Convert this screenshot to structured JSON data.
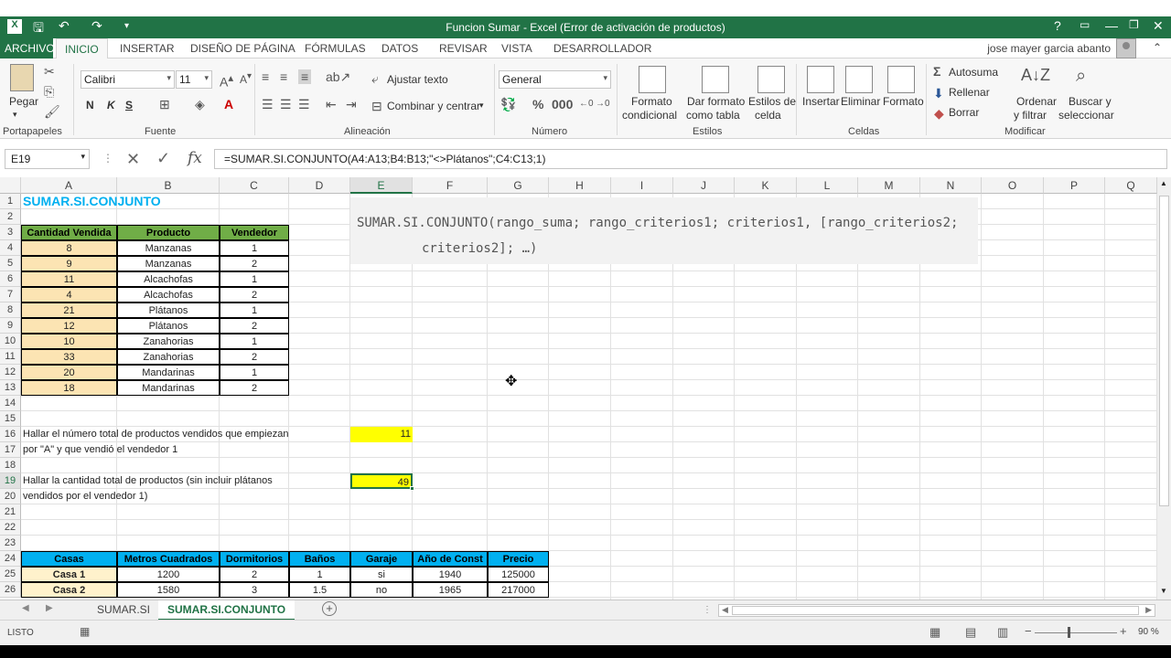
{
  "titlebar": {
    "title": "Funcion Sumar -  Excel (Error de activación de productos)",
    "help": "?",
    "minimize": "—",
    "restore": "❐",
    "close": "✕"
  },
  "tabs": {
    "file": "ARCHIVO",
    "items": [
      "INICIO",
      "INSERTAR",
      "DISEÑO DE PÁGINA",
      "FÓRMULAS",
      "DATOS",
      "REVISAR",
      "VISTA",
      "DESARROLLADOR"
    ],
    "user": "jose mayer garcia abanto"
  },
  "ribbon": {
    "paste": "Pegar",
    "clipboard_label": "Portapapeles",
    "font_name": "Calibri",
    "font_size": "11",
    "font_label": "Fuente",
    "bold": "N",
    "italic": "K",
    "underline": "S",
    "wrap_text": "Ajustar texto",
    "merge_center": "Combinar y centrar",
    "alignment_label": "Alineación",
    "number_format": "General",
    "number_label": "Número",
    "cond_format_1": "Formato",
    "cond_format_2": "condicional",
    "table_format_1": "Dar formato",
    "table_format_2": "como tabla",
    "cell_styles_1": "Estilos de",
    "cell_styles_2": "celda",
    "styles_label": "Estilos",
    "insert": "Insertar",
    "delete": "Eliminar",
    "format": "Formato",
    "cells_label": "Celdas",
    "autosum": "Autosuma",
    "fill": "Rellenar",
    "clear": "Borrar",
    "sort_1": "Ordenar",
    "sort_2": "y filtrar",
    "find_1": "Buscar y",
    "find_2": "seleccionar",
    "modify_label": "Modificar"
  },
  "formula_bar": {
    "name_box": "E19",
    "formula": "=SUMAR.SI.CONJUNTO(A4:A13;B4:B13;\"<>Plátanos\";C4:C13;1)"
  },
  "columns": [
    "A",
    "B",
    "C",
    "D",
    "E",
    "F",
    "G",
    "H",
    "I",
    "J",
    "K",
    "L",
    "M",
    "N",
    "O",
    "P",
    "Q"
  ],
  "rows": [
    "1",
    "2",
    "3",
    "4",
    "5",
    "6",
    "7",
    "8",
    "9",
    "10",
    "11",
    "12",
    "13",
    "14",
    "15",
    "16",
    "17",
    "18",
    "19",
    "20",
    "21",
    "22",
    "23",
    "24",
    "25",
    "26"
  ],
  "sheet": {
    "title": "SUMAR.SI.CONJUNTO",
    "headers": [
      "Cantidad Vendida",
      "Producto",
      "Vendedor"
    ],
    "data": [
      [
        "8",
        "Manzanas",
        "1"
      ],
      [
        "9",
        "Manzanas",
        "2"
      ],
      [
        "11",
        "Alcachofas",
        "1"
      ],
      [
        "4",
        "Alcachofas",
        "2"
      ],
      [
        "21",
        "Plátanos",
        "1"
      ],
      [
        "12",
        "Plátanos",
        "2"
      ],
      [
        "10",
        "Zanahorias",
        "1"
      ],
      [
        "33",
        "Zanahorias",
        "2"
      ],
      [
        "20",
        "Mandarinas",
        "1"
      ],
      [
        "18",
        "Mandarinas",
        "2"
      ]
    ],
    "q1_line1": "Hallar el número total de productos vendidos que empiezan",
    "q1_line2": "por \"A\" y que vendió el vendedor 1",
    "q1_result": "11",
    "q2_line1": "Hallar la cantidad total de productos (sin incluir plátanos",
    "q2_line2": "vendidos por el vendedor 1)",
    "q2_result": "49",
    "syntax_line1": "SUMAR.SI.CONJUNTO(rango_suma; rango_criterios1; criterios1, [rango_criterios2;",
    "syntax_line2": "criterios2]; …)",
    "table2_headers": [
      "Casas",
      "Metros Cuadrados",
      "Dormitorios",
      "Baños",
      "Garaje",
      "Año de Const",
      "Precio"
    ],
    "table2_rows": [
      [
        "Casa 1",
        "1200",
        "2",
        "1",
        "si",
        "1940",
        "125000"
      ],
      [
        "Casa 2",
        "1580",
        "3",
        "1.5",
        "no",
        "1965",
        "217000"
      ]
    ]
  },
  "sheet_tabs": [
    "SUMAR.SI",
    "SUMAR.SI.CONJUNTO"
  ],
  "status": {
    "ready": "LISTO",
    "zoom": "90 %"
  }
}
